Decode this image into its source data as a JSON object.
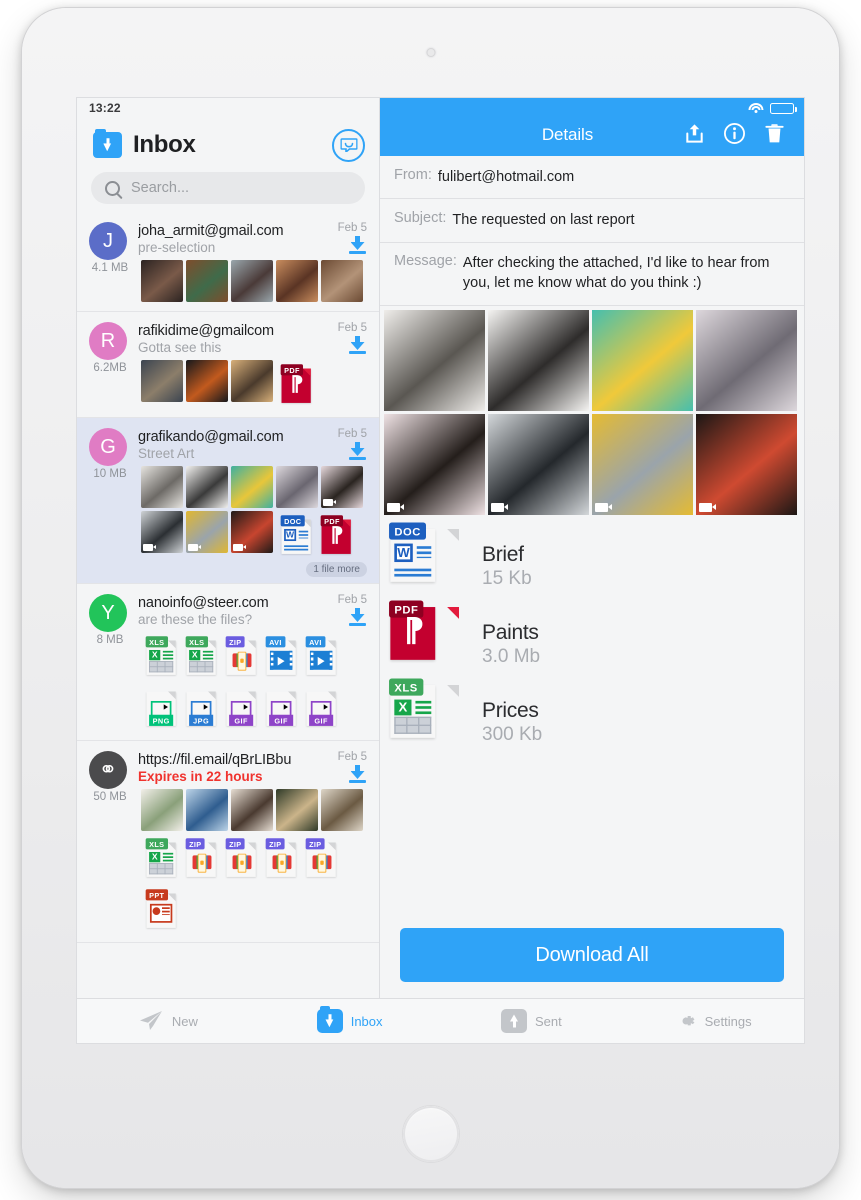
{
  "status_bar": {
    "time": "13:22",
    "wifi_icon": "wifi-icon",
    "battery_icon": "battery-icon"
  },
  "inbox": {
    "title": "Inbox",
    "folder_icon": "inbox-download-folder-icon",
    "compose_icon": "compose-message-icon",
    "search": {
      "placeholder": "Search...",
      "icon": "search-icon"
    },
    "more_badge": "1 file more",
    "emails": [
      {
        "from": "joha_armit@gmail.com",
        "subject": "pre-selection",
        "date": "Feb 5",
        "size": "4.1 MB",
        "avatar_letter": "J",
        "avatar_color": "#5b6dc8",
        "selected": false,
        "download_icon": "download-icon",
        "attachments": [
          {
            "kind": "photo",
            "c1": "#2b2321",
            "c2": "#7a5a49"
          },
          {
            "kind": "photo",
            "c1": "#7e4d2c",
            "c2": "#3f6b4a"
          },
          {
            "kind": "photo",
            "c1": "#9aa7ad",
            "c2": "#4a3a38"
          },
          {
            "kind": "photo",
            "c1": "#c98d5e",
            "c2": "#5a3424"
          },
          {
            "kind": "photo",
            "c1": "#6b4a33",
            "c2": "#b39378"
          }
        ]
      },
      {
        "from": "rafikidime@gmailcom",
        "subject": "Gotta see this",
        "date": "Feb 5",
        "size": "6.2MB",
        "avatar_letter": "R",
        "avatar_color": "#e07cc4",
        "selected": false,
        "download_icon": "download-icon",
        "attachments": [
          {
            "kind": "photo",
            "c1": "#3b4450",
            "c2": "#8c7e6a"
          },
          {
            "kind": "photo",
            "c1": "#16181c",
            "c2": "#c25a1e"
          },
          {
            "kind": "photo",
            "c1": "#d8b07a",
            "c2": "#4a3a2c"
          },
          {
            "kind": "file",
            "type": "PDF"
          }
        ]
      },
      {
        "from": "grafikando@gmail.com",
        "subject": "Street Art",
        "date": "Feb 5",
        "size": "10 MB",
        "avatar_letter": "G",
        "avatar_color": "#e07cc4",
        "selected": true,
        "download_icon": "download-icon",
        "attachments": [
          {
            "kind": "photo",
            "c1": "#e6e4e0",
            "c2": "#6d6a66"
          },
          {
            "kind": "photo",
            "c1": "#f2f1ef",
            "c2": "#3a3a3a"
          },
          {
            "kind": "photo",
            "c1": "#3fb0a0",
            "c2": "#e8c63a"
          },
          {
            "kind": "photo",
            "c1": "#ddd8dd",
            "c2": "#6a6670"
          },
          {
            "kind": "photo",
            "c1": "#e7d9dd",
            "c2": "#2a2420",
            "video": true
          },
          {
            "kind": "photo",
            "c1": "#cfd3d6",
            "c2": "#2b2f33",
            "video": true
          },
          {
            "kind": "photo",
            "c1": "#e0b731",
            "c2": "#9aa4ab",
            "video": true
          },
          {
            "kind": "photo",
            "c1": "#1f1a18",
            "c2": "#c7452f",
            "video": true
          },
          {
            "kind": "file",
            "type": "DOC"
          },
          {
            "kind": "file",
            "type": "PDF"
          }
        ]
      },
      {
        "from": "nanoinfo@steer.com",
        "subject": "are these the files?",
        "date": "Feb 5",
        "size": "8 MB",
        "avatar_letter": "Y",
        "avatar_color": "#22c45a",
        "selected": false,
        "download_icon": "download-icon",
        "attachments": [
          {
            "kind": "file",
            "type": "XLS"
          },
          {
            "kind": "file",
            "type": "XLS"
          },
          {
            "kind": "file",
            "type": "ZIP"
          },
          {
            "kind": "file",
            "type": "AVI"
          },
          {
            "kind": "file",
            "type": "AVI"
          },
          {
            "kind": "file",
            "type": "PNG"
          },
          {
            "kind": "file",
            "type": "JPG"
          },
          {
            "kind": "file",
            "type": "GIF"
          },
          {
            "kind": "file",
            "type": "GIF"
          },
          {
            "kind": "file",
            "type": "GIF"
          }
        ]
      },
      {
        "from": "https://fil.email/qBrLIBbu",
        "subject": "Expires in 22 hours",
        "subject_alert": true,
        "date": "Feb 5",
        "size": "50 MB",
        "avatar_letter": "link",
        "avatar_color": "#4b4b4d",
        "selected": false,
        "download_icon": "download-icon",
        "attachments": [
          {
            "kind": "photo",
            "c1": "#f2efe9",
            "c2": "#8aa07a"
          },
          {
            "kind": "photo",
            "c1": "#bcd4e8",
            "c2": "#2f5d8f"
          },
          {
            "kind": "photo",
            "c1": "#e6ddd2",
            "c2": "#4a3a30"
          },
          {
            "kind": "photo",
            "c1": "#2f3a28",
            "c2": "#cbb48a"
          },
          {
            "kind": "photo",
            "c1": "#ded6c8",
            "c2": "#6b5a43"
          },
          {
            "kind": "file",
            "type": "XLS"
          },
          {
            "kind": "file",
            "type": "ZIP"
          },
          {
            "kind": "file",
            "type": "ZIP"
          },
          {
            "kind": "file",
            "type": "ZIP"
          },
          {
            "kind": "file",
            "type": "ZIP"
          },
          {
            "kind": "file",
            "type": "PPT"
          }
        ]
      }
    ]
  },
  "details": {
    "title": "Details",
    "actions": [
      {
        "name": "share-icon",
        "label": "Share"
      },
      {
        "name": "info-icon",
        "label": "Info"
      },
      {
        "name": "trash-icon",
        "label": "Delete"
      }
    ],
    "from_label": "From:",
    "from_value": "fulibert@hotmail.com",
    "subject_label": "Subject:",
    "subject_value": "The requested on last report",
    "message_label": "Message:",
    "message_value": "After checking the attached, I'd like to hear from you, let me know what do you think :)",
    "gallery": [
      {
        "c1": "#efedea",
        "c2": "#5a5752",
        "video": false
      },
      {
        "c1": "#f5f4f2",
        "c2": "#2e2c2b",
        "video": false
      },
      {
        "c1": "#46bfae",
        "c2": "#f0c93a",
        "video": false
      },
      {
        "c1": "#ddd7dc",
        "c2": "#6f6b74",
        "video": false
      },
      {
        "c1": "#efe2e4",
        "c2": "#241e1b",
        "video": true
      },
      {
        "c1": "#d3d7da",
        "c2": "#24282c",
        "video": true
      },
      {
        "c1": "#e5bb32",
        "c2": "#9aa4ab",
        "video": true
      },
      {
        "c1": "#1c1715",
        "c2": "#cf4a31",
        "video": true
      }
    ],
    "files": [
      {
        "type": "DOC",
        "name": "Brief",
        "size": "15 Kb"
      },
      {
        "type": "PDF",
        "name": "Paints",
        "size": "3.0 Mb"
      },
      {
        "type": "XLS",
        "name": "Prices",
        "size": "300 Kb"
      }
    ],
    "download_all_label": "Download All"
  },
  "tabs": [
    {
      "label": "New",
      "icon": "paper-plane-icon",
      "active": false
    },
    {
      "label": "Inbox",
      "icon": "inbox-download-icon",
      "active": true
    },
    {
      "label": "Sent",
      "icon": "upload-arrow-icon",
      "active": false
    },
    {
      "label": "Settings",
      "icon": "gear-icon",
      "active": false
    }
  ],
  "colors": {
    "accent": "#2fa3f7",
    "alert": "#f0332e",
    "selected_row": "#dfe4f2"
  }
}
